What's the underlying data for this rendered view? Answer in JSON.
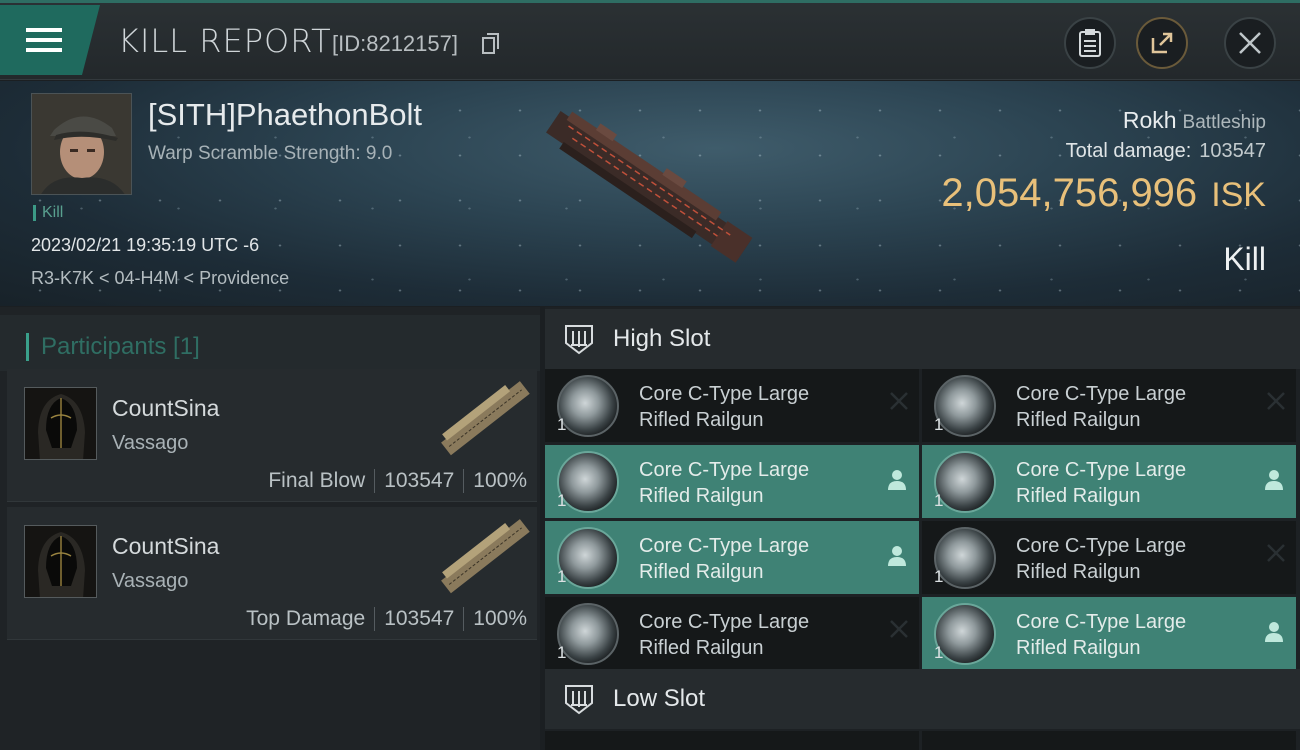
{
  "header": {
    "title": "KILL REPORT",
    "report_id": "[ID:8212157]",
    "icons": {
      "menu": "hamburger-icon",
      "copy": "copy-icon",
      "clipboard": "clipboard-icon",
      "share": "share-icon",
      "close": "close-icon"
    }
  },
  "victim": {
    "name": "[SITH]PhaethonBolt",
    "warp_scramble": "Warp Scramble Strength: 9.0",
    "tag": "Kill",
    "datetime": "2023/02/21 19:35:19 UTC -6",
    "location": "R3-K7K < 04-H4M < Providence",
    "ship_name": "Rokh",
    "ship_class": "Battleship",
    "total_damage_label": "Total damage:",
    "total_damage": "103547",
    "isk_value": "2,054,756,996",
    "isk_unit": "ISK",
    "result": "Kill"
  },
  "participants": {
    "title": "Participants [1]",
    "rows": [
      {
        "name": "CountSina",
        "ship": "Vassago",
        "role": "Final Blow",
        "damage": "103547",
        "percent": "100%"
      },
      {
        "name": "CountSina",
        "ship": "Vassago",
        "role": "Top Damage",
        "damage": "103547",
        "percent": "100%"
      }
    ]
  },
  "slots": {
    "high": {
      "title": "High Slot",
      "items": [
        {
          "line1": "Core C-Type Large",
          "line2": "Rifled Railgun",
          "qty": "1",
          "status": "destroyed"
        },
        {
          "line1": "Core C-Type Large",
          "line2": "Rifled Railgun",
          "qty": "1",
          "status": "destroyed"
        },
        {
          "line1": "Core C-Type Large",
          "line2": "Rifled Railgun",
          "qty": "1",
          "status": "dropped"
        },
        {
          "line1": "Core C-Type Large",
          "line2": "Rifled Railgun",
          "qty": "1",
          "status": "dropped"
        },
        {
          "line1": "Core C-Type Large",
          "line2": "Rifled Railgun",
          "qty": "1",
          "status": "dropped"
        },
        {
          "line1": "Core C-Type Large",
          "line2": "Rifled Railgun",
          "qty": "1",
          "status": "destroyed"
        },
        {
          "line1": "Core C-Type Large",
          "line2": "Rifled Railgun",
          "qty": "1",
          "status": "destroyed"
        },
        {
          "line1": "Core C-Type Large",
          "line2": "Rifled Railgun",
          "qty": "1",
          "status": "dropped"
        }
      ]
    },
    "low": {
      "title": "Low Slot"
    }
  },
  "colors": {
    "accent": "#3f8275",
    "isk": "#e8c07a",
    "header_accent": "#1f6a5e"
  }
}
